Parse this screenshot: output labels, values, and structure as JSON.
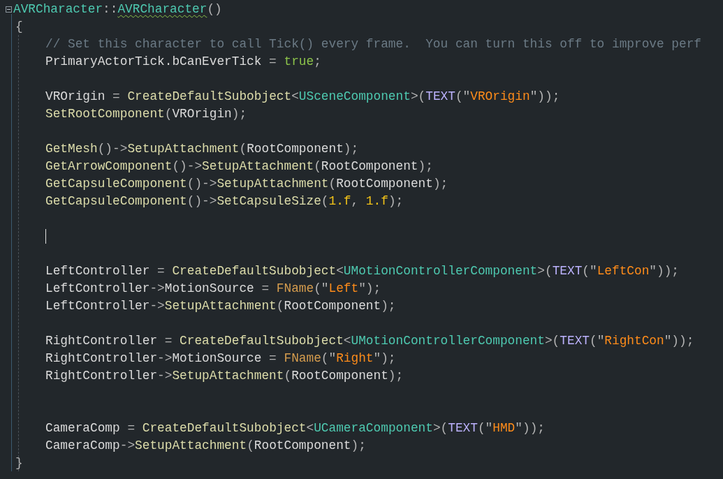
{
  "editor": {
    "header": {
      "tokens": [
        {
          "kind": "type",
          "text": "AVRCharacter"
        },
        {
          "kind": "punct",
          "text": "::"
        },
        {
          "kind": "type",
          "text": "AVRCharacter",
          "squiggle": true
        },
        {
          "kind": "punct",
          "text": "()"
        }
      ]
    },
    "open_brace": "{",
    "lines": [
      {
        "kind": "code",
        "tokens": [
          {
            "kind": "comment",
            "text": "// Set this character to call Tick() every frame.  You can turn this off to improve perf"
          }
        ]
      },
      {
        "kind": "code",
        "tokens": [
          {
            "kind": "plain",
            "text": "PrimaryActorTick.bCanEverTick"
          },
          {
            "kind": "punct",
            "text": " = "
          },
          {
            "kind": "keyword",
            "text": "true"
          },
          {
            "kind": "punct",
            "text": ";"
          }
        ]
      },
      {
        "kind": "blank"
      },
      {
        "kind": "code",
        "tokens": [
          {
            "kind": "plain",
            "text": "VROrigin"
          },
          {
            "kind": "punct",
            "text": " = "
          },
          {
            "kind": "function",
            "text": "CreateDefaultSubobject"
          },
          {
            "kind": "punct",
            "text": "<"
          },
          {
            "kind": "type",
            "text": "USceneComponent"
          },
          {
            "kind": "punct",
            "text": ">("
          },
          {
            "kind": "macro",
            "text": "TEXT"
          },
          {
            "kind": "punct",
            "text": "(\""
          },
          {
            "kind": "string",
            "text": "VROrigin"
          },
          {
            "kind": "punct",
            "text": "\"));"
          }
        ]
      },
      {
        "kind": "code",
        "tokens": [
          {
            "kind": "function",
            "text": "SetRootComponent"
          },
          {
            "kind": "punct",
            "text": "("
          },
          {
            "kind": "plain",
            "text": "VROrigin"
          },
          {
            "kind": "punct",
            "text": ");"
          }
        ]
      },
      {
        "kind": "blank"
      },
      {
        "kind": "code",
        "tokens": [
          {
            "kind": "function",
            "text": "GetMesh"
          },
          {
            "kind": "punct",
            "text": "()->"
          },
          {
            "kind": "function",
            "text": "SetupAttachment"
          },
          {
            "kind": "punct",
            "text": "("
          },
          {
            "kind": "plain",
            "text": "RootComponent"
          },
          {
            "kind": "punct",
            "text": ");"
          }
        ]
      },
      {
        "kind": "code",
        "tokens": [
          {
            "kind": "function",
            "text": "GetArrowComponent"
          },
          {
            "kind": "punct",
            "text": "()->"
          },
          {
            "kind": "function",
            "text": "SetupAttachment"
          },
          {
            "kind": "punct",
            "text": "("
          },
          {
            "kind": "plain",
            "text": "RootComponent"
          },
          {
            "kind": "punct",
            "text": ");"
          }
        ]
      },
      {
        "kind": "code",
        "tokens": [
          {
            "kind": "function",
            "text": "GetCapsuleComponent"
          },
          {
            "kind": "punct",
            "text": "()->"
          },
          {
            "kind": "function",
            "text": "SetupAttachment"
          },
          {
            "kind": "punct",
            "text": "("
          },
          {
            "kind": "plain",
            "text": "RootComponent"
          },
          {
            "kind": "punct",
            "text": ");"
          }
        ]
      },
      {
        "kind": "code",
        "tokens": [
          {
            "kind": "function",
            "text": "GetCapsuleComponent"
          },
          {
            "kind": "punct",
            "text": "()->"
          },
          {
            "kind": "function",
            "text": "SetCapsuleSize"
          },
          {
            "kind": "punct",
            "text": "("
          },
          {
            "kind": "number",
            "text": "1.f"
          },
          {
            "kind": "punct",
            "text": ", "
          },
          {
            "kind": "number",
            "text": "1.f"
          },
          {
            "kind": "punct",
            "text": ");"
          }
        ]
      },
      {
        "kind": "blank"
      },
      {
        "kind": "caret"
      },
      {
        "kind": "blank"
      },
      {
        "kind": "code",
        "tokens": [
          {
            "kind": "plain",
            "text": "LeftController"
          },
          {
            "kind": "punct",
            "text": " = "
          },
          {
            "kind": "function",
            "text": "CreateDefaultSubobject"
          },
          {
            "kind": "punct",
            "text": "<"
          },
          {
            "kind": "type",
            "text": "UMotionControllerComponent"
          },
          {
            "kind": "punct",
            "text": ">("
          },
          {
            "kind": "macro",
            "text": "TEXT"
          },
          {
            "kind": "punct",
            "text": "(\""
          },
          {
            "kind": "string",
            "text": "LeftCon"
          },
          {
            "kind": "punct",
            "text": "\"));"
          }
        ]
      },
      {
        "kind": "code",
        "tokens": [
          {
            "kind": "plain",
            "text": "LeftController"
          },
          {
            "kind": "punct",
            "text": "->"
          },
          {
            "kind": "plain",
            "text": "MotionSource"
          },
          {
            "kind": "punct",
            "text": " = "
          },
          {
            "kind": "macro2",
            "text": "FName"
          },
          {
            "kind": "punct",
            "text": "(\""
          },
          {
            "kind": "string",
            "text": "Left"
          },
          {
            "kind": "punct",
            "text": "\");"
          }
        ]
      },
      {
        "kind": "code",
        "tokens": [
          {
            "kind": "plain",
            "text": "LeftController"
          },
          {
            "kind": "punct",
            "text": "->"
          },
          {
            "kind": "function",
            "text": "SetupAttachment"
          },
          {
            "kind": "punct",
            "text": "("
          },
          {
            "kind": "plain",
            "text": "RootComponent"
          },
          {
            "kind": "punct",
            "text": ");"
          }
        ]
      },
      {
        "kind": "blank"
      },
      {
        "kind": "code",
        "tokens": [
          {
            "kind": "plain",
            "text": "RightController"
          },
          {
            "kind": "punct",
            "text": " = "
          },
          {
            "kind": "function",
            "text": "CreateDefaultSubobject"
          },
          {
            "kind": "punct",
            "text": "<"
          },
          {
            "kind": "type",
            "text": "UMotionControllerComponent"
          },
          {
            "kind": "punct",
            "text": ">("
          },
          {
            "kind": "macro",
            "text": "TEXT"
          },
          {
            "kind": "punct",
            "text": "(\""
          },
          {
            "kind": "string",
            "text": "RightCon"
          },
          {
            "kind": "punct",
            "text": "\"));"
          }
        ]
      },
      {
        "kind": "code",
        "tokens": [
          {
            "kind": "plain",
            "text": "RightController"
          },
          {
            "kind": "punct",
            "text": "->"
          },
          {
            "kind": "plain",
            "text": "MotionSource"
          },
          {
            "kind": "punct",
            "text": " = "
          },
          {
            "kind": "macro2",
            "text": "FName"
          },
          {
            "kind": "punct",
            "text": "(\""
          },
          {
            "kind": "string",
            "text": "Right"
          },
          {
            "kind": "punct",
            "text": "\");"
          }
        ]
      },
      {
        "kind": "code",
        "tokens": [
          {
            "kind": "plain",
            "text": "RightController"
          },
          {
            "kind": "punct",
            "text": "->"
          },
          {
            "kind": "function",
            "text": "SetupAttachment"
          },
          {
            "kind": "punct",
            "text": "("
          },
          {
            "kind": "plain",
            "text": "RootComponent"
          },
          {
            "kind": "punct",
            "text": ");"
          }
        ]
      },
      {
        "kind": "blank"
      },
      {
        "kind": "blank"
      },
      {
        "kind": "code",
        "tokens": [
          {
            "kind": "plain",
            "text": "CameraComp"
          },
          {
            "kind": "punct",
            "text": " = "
          },
          {
            "kind": "function",
            "text": "CreateDefaultSubobject"
          },
          {
            "kind": "punct",
            "text": "<"
          },
          {
            "kind": "type",
            "text": "UCameraComponent"
          },
          {
            "kind": "punct",
            "text": ">("
          },
          {
            "kind": "macro",
            "text": "TEXT"
          },
          {
            "kind": "punct",
            "text": "(\""
          },
          {
            "kind": "string",
            "text": "HMD"
          },
          {
            "kind": "punct",
            "text": "\"));"
          }
        ]
      },
      {
        "kind": "code",
        "tokens": [
          {
            "kind": "plain",
            "text": "CameraComp"
          },
          {
            "kind": "punct",
            "text": "->"
          },
          {
            "kind": "function",
            "text": "SetupAttachment"
          },
          {
            "kind": "punct",
            "text": "("
          },
          {
            "kind": "plain",
            "text": "RootComponent"
          },
          {
            "kind": "punct",
            "text": ");"
          }
        ]
      }
    ],
    "close_brace": "}"
  }
}
